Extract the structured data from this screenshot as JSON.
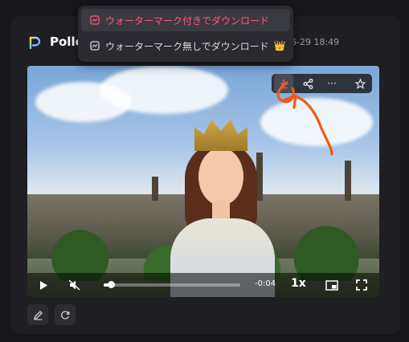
{
  "header": {
    "app_title": "Pollo",
    "timestamp": "06-29 18:49"
  },
  "download_menu": {
    "items": [
      {
        "label": "ウォーターマーク付きでダウンロード",
        "icon": "watermark-icon",
        "highlighted": true
      },
      {
        "label": "ウォーターマーク無しでダウンロード",
        "icon": "no-watermark-icon",
        "badge_icon": "crown-emoji-icon",
        "badge": "👑"
      }
    ]
  },
  "video_toolbar": {
    "buttons": [
      "download-icon",
      "share-icon",
      "more-icon",
      "star-icon"
    ],
    "more_label": "···"
  },
  "player": {
    "play_icon": "play-icon",
    "mute_icon": "muted-speaker-icon",
    "time_remaining": "-0:04",
    "speed": "1x",
    "progress": 0.05,
    "pip_icon": "picture-in-picture-icon",
    "fullscreen_icon": "fullscreen-icon"
  },
  "actions": {
    "edit_icon": "pencil-icon",
    "regenerate_icon": "refresh-icon"
  },
  "colors": {
    "accent": "#ff4a6a",
    "annotation": "#f05a16"
  }
}
